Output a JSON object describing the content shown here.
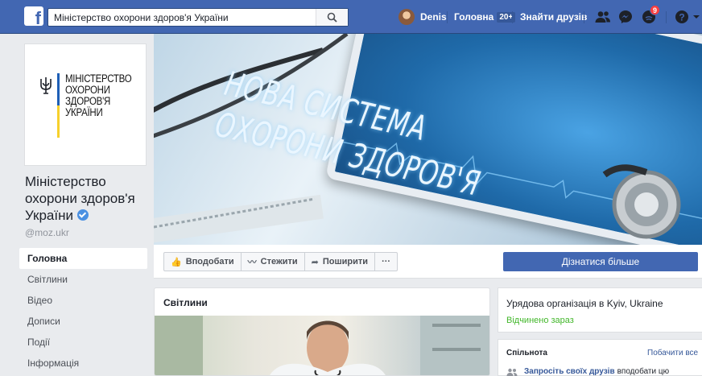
{
  "topbar": {
    "search_value": "Міністерство охорони здоров'я України",
    "user_name": "Denis",
    "home_label": "Головна",
    "home_count": "20+",
    "find_friends_label": "Знайти друзів",
    "notifications_count": "9"
  },
  "profile": {
    "logo_lines": [
      "Міністерство",
      "охорони",
      "здоров'я",
      "України"
    ],
    "name": "Міністерство охорони здоров'я України",
    "handle": "@moz.ukr"
  },
  "left_nav": {
    "items": [
      "Головна",
      "Світлини",
      "Відео",
      "Дописи",
      "Події",
      "Інформація"
    ]
  },
  "cover": {
    "lines": [
      "НОВА СИСТЕМА",
      "ОХОРОНИ ЗДОРОВ'Я"
    ]
  },
  "actions": {
    "like": "Вподобати",
    "follow": "Стежити",
    "share": "Поширити",
    "more": "···",
    "learn_more": "Дізнатися більше"
  },
  "photos": {
    "title": "Світлини"
  },
  "info": {
    "org_type": "Урядова організація в Kyiv, Ukraine",
    "open_status": "Відчинено зараз"
  },
  "community": {
    "title": "Спільнота",
    "see_all": "Побачити все",
    "invite_link": "Запросіть своїх друзів",
    "invite_rest": "вподобати цю"
  },
  "colors": {
    "fb_blue": "#4267b2",
    "background": "#e9ebee",
    "link": "#365899",
    "open_green": "#42b72a"
  }
}
